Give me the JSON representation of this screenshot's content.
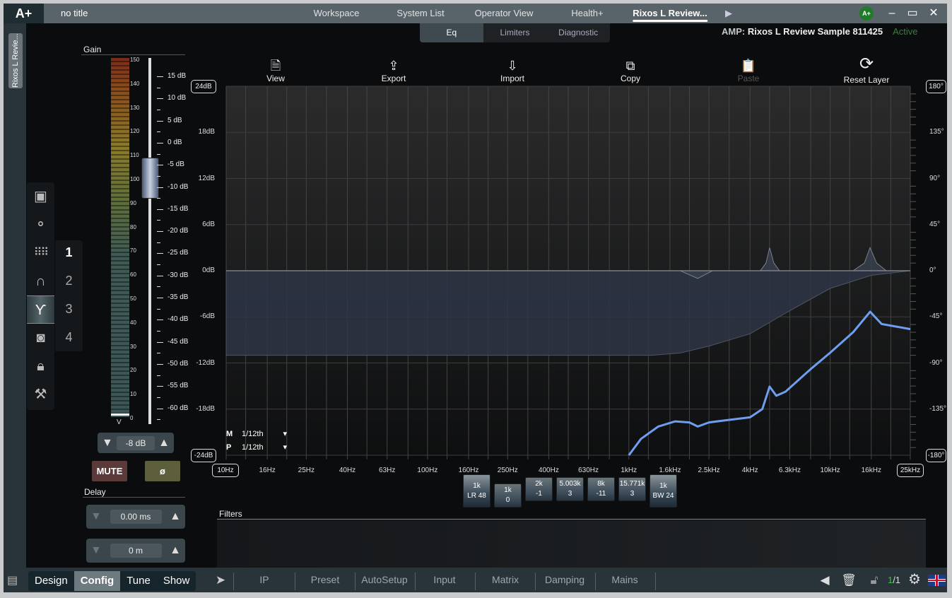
{
  "titlebar": {
    "logo": "A+",
    "doc_title": "no title",
    "tabs": [
      "Workspace",
      "System List",
      "Operator View",
      "Health+",
      "Rixos L Review..."
    ],
    "selected_tab": "Rixos L Review...",
    "more": "▶",
    "badge": "A+",
    "minimize": "–",
    "maximize": "▭",
    "close": "✕"
  },
  "side_tab": "Rixos L Revie...",
  "eq_tabs": {
    "items": [
      "Eq",
      "Limiters",
      "Diagnostic"
    ],
    "selected": "Eq"
  },
  "amp": {
    "label": "AMP:",
    "name": "Rixos L Review Sample 811425",
    "status": "Active",
    "status_color": "#3f7a45"
  },
  "toolbar": [
    {
      "label": "View",
      "icon": "view-doc-icon",
      "glyph": "🗎"
    },
    {
      "label": "Export",
      "icon": "export-icon",
      "glyph": "⇪"
    },
    {
      "label": "Import",
      "icon": "import-icon",
      "glyph": "⇩"
    },
    {
      "label": "Copy",
      "icon": "copy-icon",
      "glyph": "⧉"
    },
    {
      "label": "Paste",
      "icon": "paste-icon",
      "glyph": "📋",
      "disabled": true
    },
    {
      "label": "Reset Layer",
      "icon": "reset-icon",
      "glyph": "⟳"
    }
  ],
  "gain": {
    "title": "Gain",
    "meter_ticks": [
      "150",
      "140",
      "130",
      "120",
      "110",
      "100",
      "90",
      "80",
      "70",
      "60",
      "50",
      "40",
      "30",
      "20",
      "10",
      "0"
    ],
    "meter_unit": "V",
    "scale": [
      "15 dB",
      "10 dB",
      "5 dB",
      "0 dB",
      "-5 dB",
      "-10 dB",
      "-15 dB",
      "-20 dB",
      "-25 dB",
      "-30 dB",
      "-35 dB",
      "-40 dB",
      "-45 dB",
      "-50 dB",
      "-55 dB",
      "-60 dB"
    ],
    "value": "-8 dB",
    "fader_db": -8,
    "mute": "MUTE",
    "phase": "ø"
  },
  "delay": {
    "title": "Delay",
    "time": "0.00 ms",
    "distance": "0 m"
  },
  "side_icons": [
    "chip-icon",
    "routing-icon",
    "matrix-icon",
    "bandpass-icon",
    "crossover-icon",
    "speaker-icon",
    "lock-icon",
    "tools-icon"
  ],
  "selected_side_icon": "crossover-icon",
  "channels": {
    "items": [
      "1",
      "2",
      "3",
      "4"
    ],
    "selected": "1"
  },
  "smoothing": {
    "m_label": "M",
    "m_value": "1/12th",
    "p_label": "P",
    "p_value": "1/12th"
  },
  "filters_title": "Filters",
  "filter_buttons": [
    {
      "top": "1k",
      "bottom": "LR 48",
      "tall": true
    },
    {
      "top": "1k",
      "bottom": "0"
    },
    {
      "top": "2k",
      "bottom": "-1"
    },
    {
      "top": "5.003k",
      "bottom": "3"
    },
    {
      "top": "8k",
      "bottom": "-11"
    },
    {
      "top": "15.771k",
      "bottom": "3"
    },
    {
      "top": "1k",
      "bottom": "BW 24",
      "tall": true
    }
  ],
  "chart_data": {
    "type": "line",
    "x_scale": "log",
    "xlim": [
      10,
      25000
    ],
    "ylim": [
      -24,
      24
    ],
    "y2lim": [
      -180,
      180
    ],
    "x_ticks": [
      "10Hz",
      "16Hz",
      "25Hz",
      "40Hz",
      "63Hz",
      "100Hz",
      "160Hz",
      "250Hz",
      "400Hz",
      "630Hz",
      "1kHz",
      "1.6kHz",
      "2.5kHz",
      "4kHz",
      "6.3kHz",
      "10kHz",
      "16kHz",
      "25kHz"
    ],
    "x_tick_values": [
      10,
      16,
      25,
      40,
      63,
      100,
      160,
      250,
      400,
      630,
      1000,
      1600,
      2500,
      4000,
      6300,
      10000,
      16000,
      25000
    ],
    "y_ticks": [
      "24dB",
      "18dB",
      "12dB",
      "6dB",
      "0dB",
      "-6dB",
      "-12dB",
      "-18dB",
      "-24dB"
    ],
    "y2_ticks": [
      "180°",
      "135°",
      "90°",
      "45°",
      "0°",
      "-45°",
      "-90°",
      "-135°",
      "-180°"
    ],
    "grid": true,
    "magnitude": [
      [
        10,
        0
      ],
      [
        1000,
        0
      ],
      [
        1800,
        0
      ],
      [
        2200,
        -1
      ],
      [
        2600,
        0
      ],
      [
        4500,
        0
      ],
      [
        4800,
        1
      ],
      [
        5003,
        3
      ],
      [
        5250,
        1
      ],
      [
        5600,
        0
      ],
      [
        13000,
        0
      ],
      [
        14800,
        1
      ],
      [
        15771,
        3
      ],
      [
        17000,
        1
      ],
      [
        19000,
        0
      ],
      [
        25000,
        0
      ]
    ],
    "shaded_lower": [
      [
        10,
        -11
      ],
      [
        1300,
        -11
      ],
      [
        1800,
        -10.7
      ],
      [
        2500,
        -9.8
      ],
      [
        4000,
        -8.2
      ],
      [
        6300,
        -5.2
      ],
      [
        10000,
        -2.3
      ],
      [
        16000,
        -0.6
      ],
      [
        25000,
        0
      ]
    ],
    "phase": [
      [
        1000,
        -180
      ],
      [
        1150,
        -164
      ],
      [
        1400,
        -152
      ],
      [
        1700,
        -147
      ],
      [
        2000,
        -148
      ],
      [
        2200,
        -152
      ],
      [
        2500,
        -148
      ],
      [
        3000,
        -146
      ],
      [
        4000,
        -143
      ],
      [
        4600,
        -135
      ],
      [
        5000,
        -113
      ],
      [
        5400,
        -122
      ],
      [
        6000,
        -118
      ],
      [
        8000,
        -96
      ],
      [
        10000,
        -80
      ],
      [
        13000,
        -60
      ],
      [
        15800,
        -40
      ],
      [
        18000,
        -52
      ],
      [
        25000,
        -57
      ]
    ],
    "colors": {
      "phase": "#6f9ef0",
      "magnitude_fill": "#3a4250"
    }
  },
  "bottom": {
    "modes": [
      "Design",
      "Config",
      "Tune",
      "Show"
    ],
    "selected_mode": "Config",
    "nav": [
      "IP",
      "Preset",
      "AutoSetup",
      "Input",
      "Matrix",
      "Damping",
      "Mains"
    ],
    "page_current": "1",
    "page_total": "/1"
  }
}
